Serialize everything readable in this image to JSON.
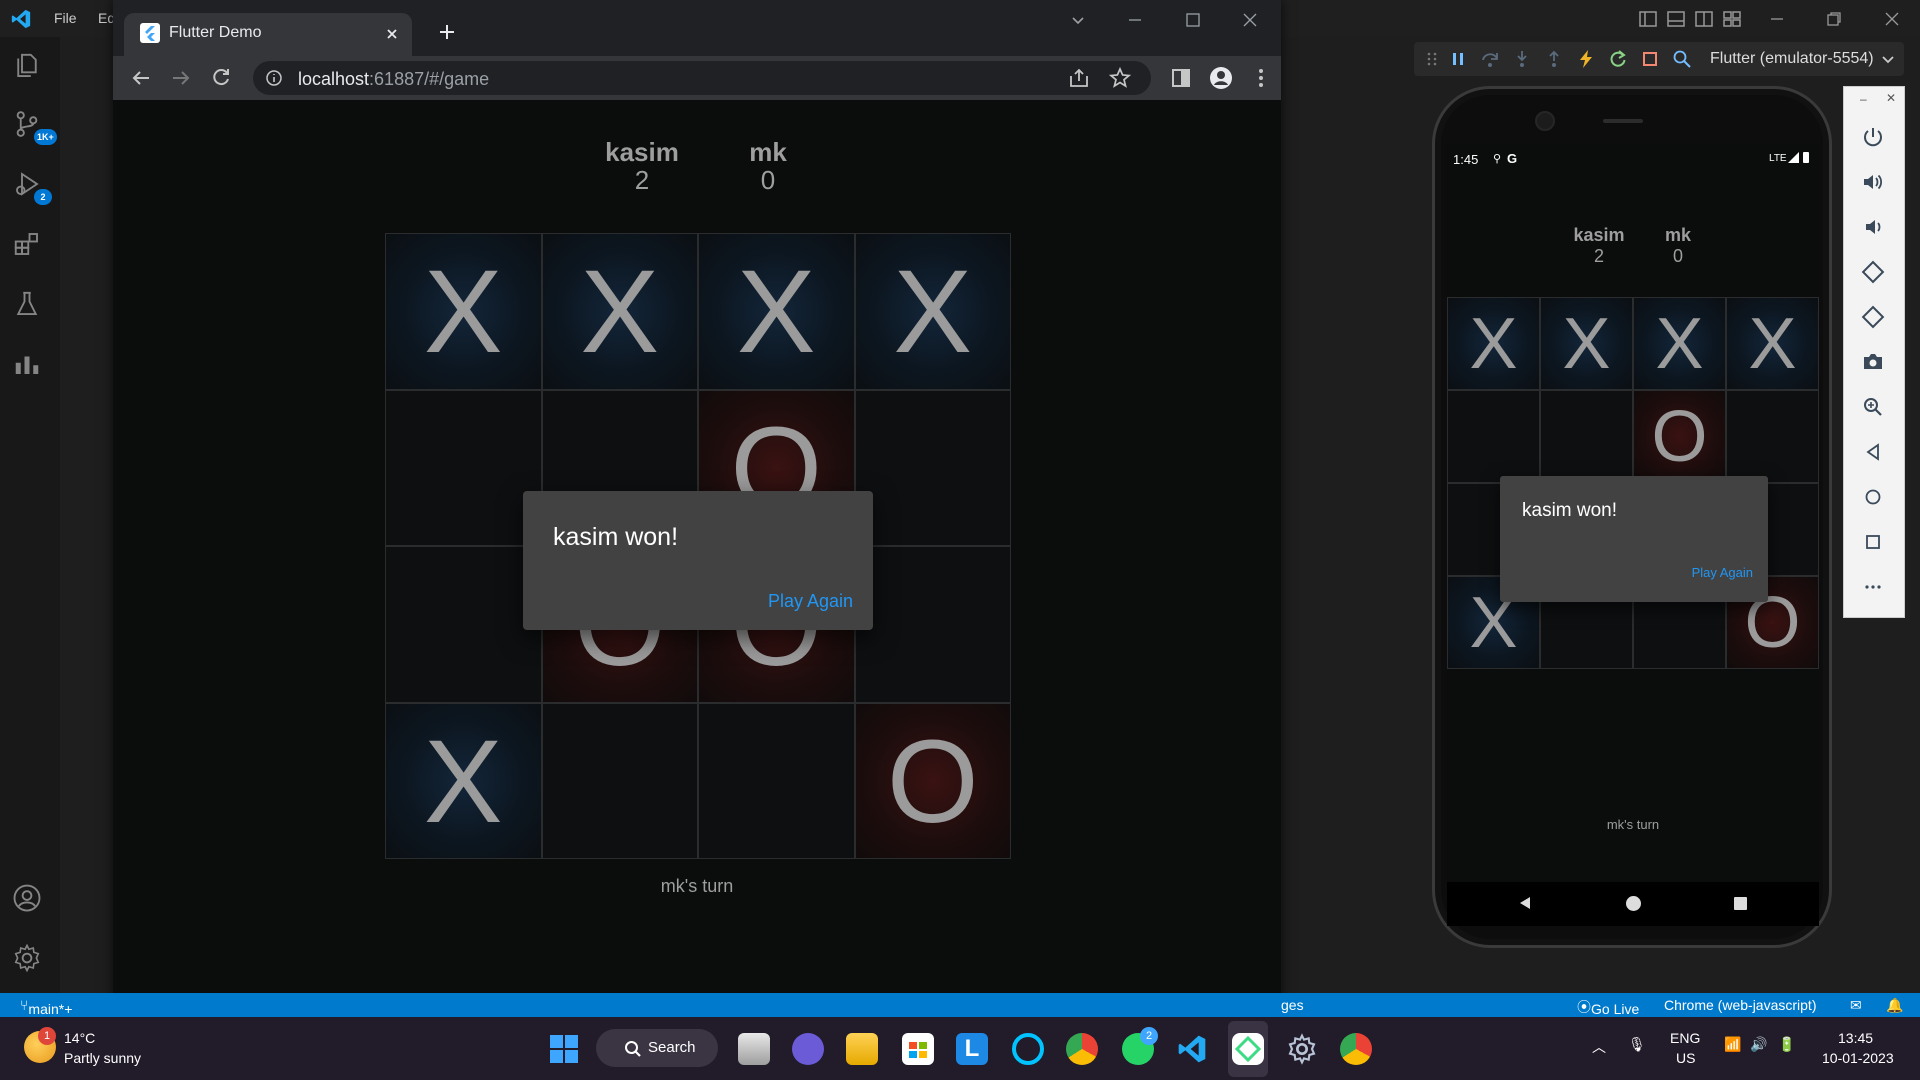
{
  "vscode": {
    "menu": [
      "File",
      "Ed"
    ],
    "activity": {
      "source_control_badge": "1K+",
      "run_debug_badge": "2"
    },
    "debug_target": "Flutter (emulator-5554)",
    "statusbar": {
      "branch": "main*+",
      "partial": "ges",
      "go_live": "Go Live",
      "debug_config": "Chrome (web-javascript)"
    }
  },
  "browser": {
    "tab_title": "Flutter Demo",
    "url_host": "localhost",
    "url_rest": ":61887/#/game"
  },
  "game": {
    "players": [
      {
        "name": "kasim",
        "score": "2"
      },
      {
        "name": "mk",
        "score": "0"
      }
    ],
    "board": [
      [
        "X",
        "X",
        "X",
        "X"
      ],
      [
        "",
        "",
        "O",
        ""
      ],
      [
        "",
        "O",
        "O",
        ""
      ],
      [
        "X",
        "",
        "",
        "O"
      ]
    ],
    "dialog_title": "kasim won!",
    "dialog_action": "Play Again",
    "turn_text": "mk's turn",
    "accent_color": "#2196f3",
    "x_glow_color": "#13263a",
    "o_glow_color": "#3a1212"
  },
  "phone": {
    "time": "1:45",
    "network": "LTE",
    "board": [
      [
        "X",
        "X",
        "X",
        "X"
      ],
      [
        "",
        "",
        "O",
        ""
      ],
      [
        "",
        "",
        "",
        ""
      ],
      [
        "X",
        "",
        "",
        "O"
      ]
    ]
  },
  "taskbar": {
    "weather_temp": "14°C",
    "weather_desc": "Partly sunny",
    "weather_badge": "1",
    "search_label": "Search",
    "whatsapp_badge": "2",
    "lang": "ENG",
    "region": "US",
    "time": "13:45",
    "date": "10-01-2023"
  }
}
